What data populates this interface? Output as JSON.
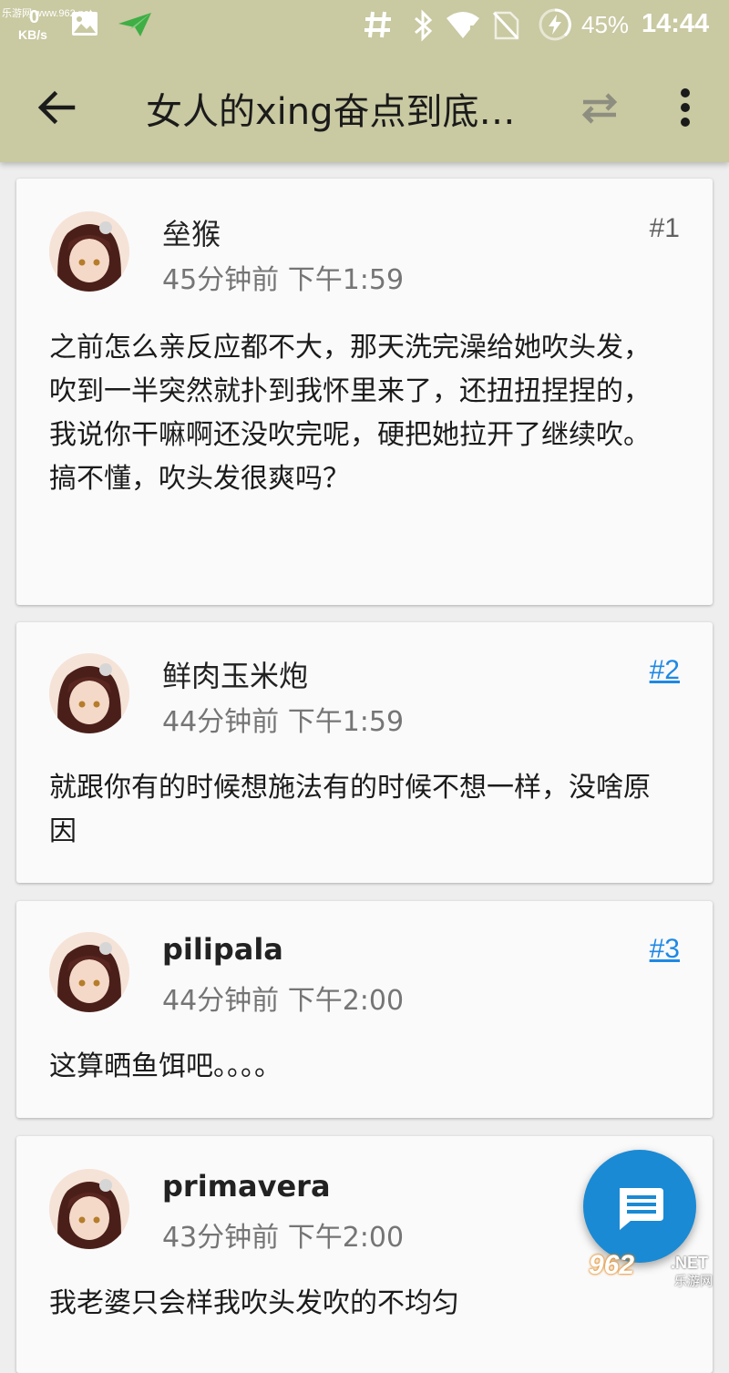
{
  "status_bar": {
    "watermark": "乐游网 www.962.net",
    "net_speed_value": "0",
    "net_speed_unit": "KB/s",
    "battery_percent": "45%",
    "time": "14:44",
    "icons": [
      "image-icon",
      "send-icon",
      "hash-icon",
      "bluetooth-icon",
      "wifi-icon",
      "no-sim-icon",
      "battery-charging-icon"
    ]
  },
  "toolbar": {
    "title": "女人的xing奋点到底…",
    "back_icon": "back-arrow-icon",
    "swap_icon": "swap-icon",
    "more_icon": "more-vert-icon",
    "background": "#c9c9a2"
  },
  "posts": [
    {
      "author": "垒猴",
      "time": "45分钟前 下午1:59",
      "floor": "#1",
      "content": "之前怎么亲反应都不大，那天洗完澡给她吹头发，吹到一半突然就扑到我怀里来了，还扭扭捏捏的，我说你干嘛啊还没吹完呢，硬把她拉开了继续吹。搞不懂，吹头发很爽吗？"
    },
    {
      "author": "鲜肉玉米炮",
      "time": "44分钟前 下午1:59",
      "floor": "#2",
      "content": "就跟你有的时候想施法有的时候不想一样，没啥原因"
    },
    {
      "author": "pilipala",
      "time": "44分钟前 下午2:00",
      "floor": "#3",
      "content": "这算晒鱼饵吧。。。。"
    },
    {
      "author": "primavera",
      "time": "43分钟前 下午2:00",
      "floor": "",
      "content": "我老婆只会样我吹头发吹的不均匀"
    }
  ],
  "fab": {
    "icon": "reply-message-icon",
    "color": "#1a8ad4"
  },
  "bottom_watermark": {
    "logo": "962",
    "net": ".NET",
    "sub": "乐游网"
  },
  "colors": {
    "link": "#1e88e5",
    "card": "#fafafa",
    "page_bg": "#eeeeee"
  }
}
